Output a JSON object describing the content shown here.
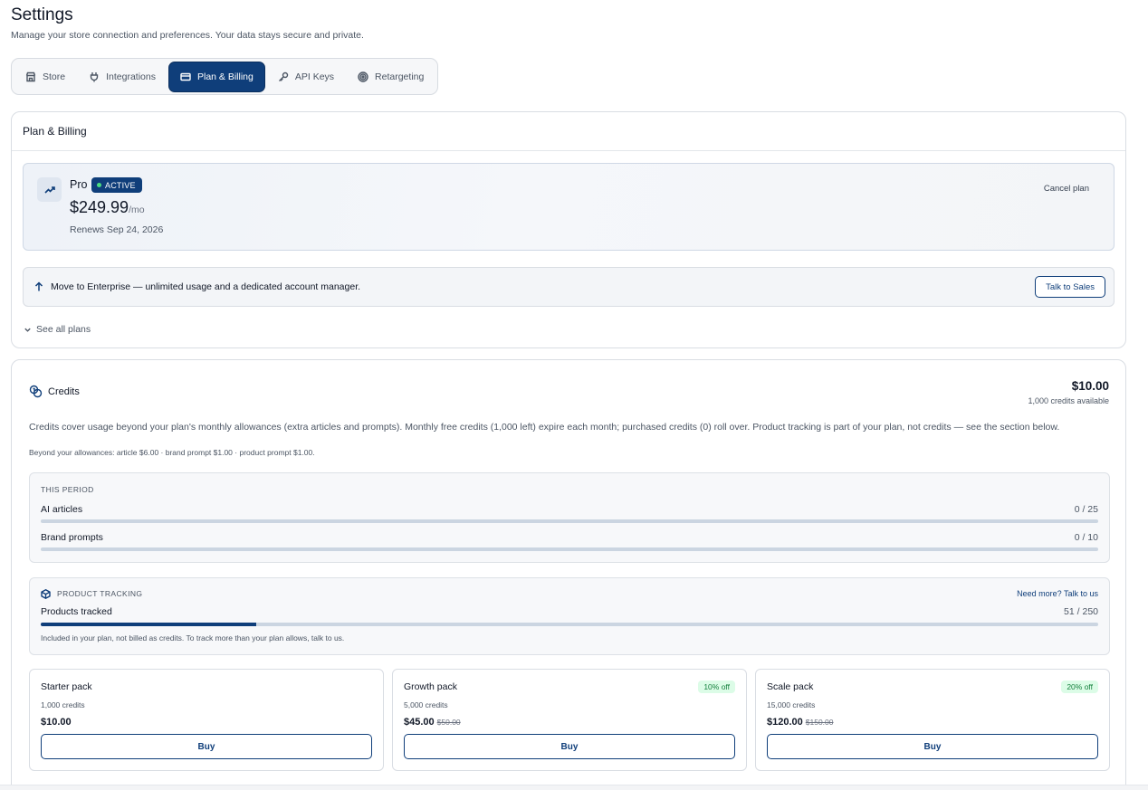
{
  "page": {
    "title": "Settings",
    "subtitle": "Manage your store connection and preferences. Your data stays secure and private."
  },
  "tabs": [
    {
      "label": "Store",
      "icon": "store-icon",
      "active": false
    },
    {
      "label": "Integrations",
      "icon": "plug-icon",
      "active": false
    },
    {
      "label": "Plan & Billing",
      "icon": "credit-card-icon",
      "active": true
    },
    {
      "label": "API Keys",
      "icon": "key-icon",
      "active": false
    },
    {
      "label": "Retargeting",
      "icon": "target-icon",
      "active": false
    }
  ],
  "plan_card": {
    "header": "Plan & Billing",
    "plan_name": "Pro",
    "status_badge": "ACTIVE",
    "price": "$249.99",
    "price_period": "/mo",
    "renews": "Renews Sep 24, 2026",
    "cancel_label": "Cancel plan",
    "upgrade_text": "Move to Enterprise — unlimited usage and a dedicated account manager.",
    "talk_sales_label": "Talk to Sales",
    "see_all_label": "See all plans"
  },
  "credits": {
    "title": "Credits",
    "amount": "$10.00",
    "available": "1,000 credits available",
    "description": "Credits cover usage beyond your plan's monthly allowances (extra articles and prompts). Monthly free credits (1,000 left) expire each month; purchased credits (0) roll over. Product tracking is part of your plan, not credits — see the section below.",
    "beyond": "Beyond your allowances: article $6.00 · brand prompt $1.00 · product prompt $1.00.",
    "period": {
      "label": "THIS PERIOD",
      "items": [
        {
          "label": "AI articles",
          "value": "0 / 25",
          "fraction": 0
        },
        {
          "label": "Brand prompts",
          "value": "0 / 10",
          "fraction": 0
        }
      ]
    },
    "tracking": {
      "label": "PRODUCT TRACKING",
      "need_more": "Need more? Talk to us",
      "item_label": "Products tracked",
      "item_value": "51 / 250",
      "fraction": 0.204,
      "note": "Included in your plan, not billed as credits. To track more than your plan allows, talk to us."
    },
    "packs": [
      {
        "name": "Starter pack",
        "credits": "1,000 credits",
        "price": "$10.00",
        "old_price": "",
        "discount": "",
        "buy_label": "Buy"
      },
      {
        "name": "Growth pack",
        "credits": "5,000 credits",
        "price": "$45.00",
        "old_price": "$50.00",
        "discount": "10% off",
        "buy_label": "Buy"
      },
      {
        "name": "Scale pack",
        "credits": "15,000 credits",
        "price": "$120.00",
        "old_price": "$150.00",
        "discount": "20% off",
        "buy_label": "Buy"
      }
    ]
  },
  "colors": {
    "accent": "#0f3e7a",
    "success": "#15803d",
    "success_bg": "#dcfce7",
    "active_dot": "#4ade80"
  }
}
